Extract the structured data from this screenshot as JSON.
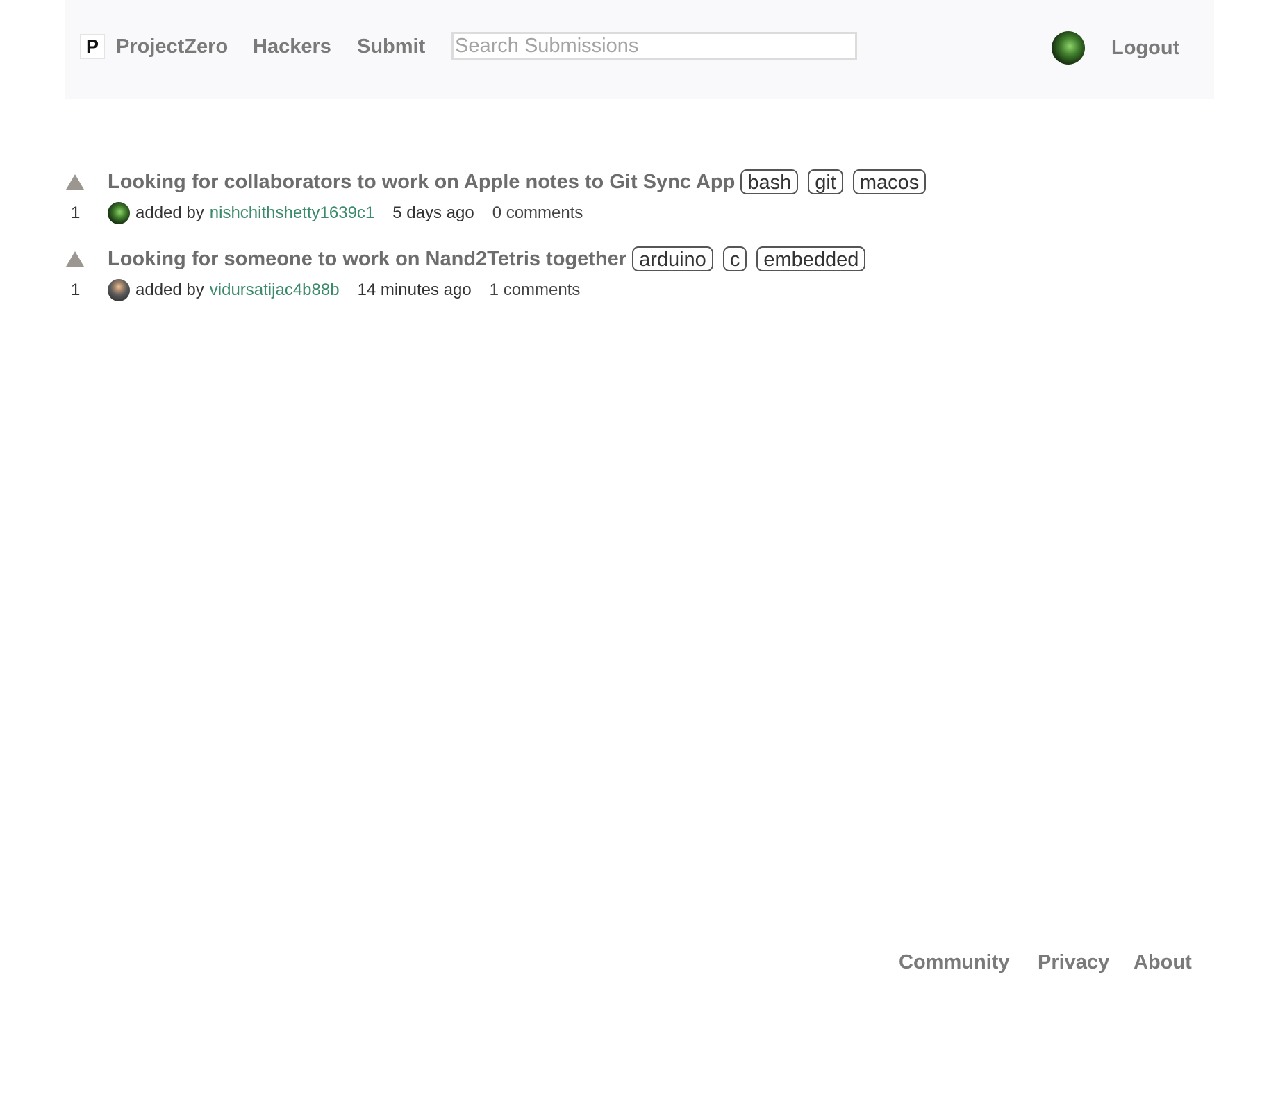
{
  "header": {
    "logo_letter": "P",
    "brand": "ProjectZero",
    "nav": {
      "hackers": "Hackers",
      "submit": "Submit"
    },
    "search": {
      "placeholder": "Search Submissions",
      "value": ""
    },
    "logout": "Logout"
  },
  "submissions": [
    {
      "title": "Looking for collaborators to work on Apple notes to Git Sync App",
      "tags": [
        "bash",
        "git",
        "macos"
      ],
      "points": "1",
      "added_by_label": "added by",
      "author": "nishchithshetty1639c1",
      "time": "5 days ago",
      "comments": "0 comments"
    },
    {
      "title": "Looking for someone to work on Nand2Tetris together",
      "tags": [
        "arduino",
        "c",
        "embedded"
      ],
      "points": "1",
      "added_by_label": "added by",
      "author": "vidursatijac4b88b",
      "time": "14 minutes ago",
      "comments": "1 comments"
    }
  ],
  "footer": {
    "community": "Community",
    "privacy": "Privacy",
    "about": "About"
  },
  "colors": {
    "nav_background": "#f9f9fb",
    "nav_text": "#7a7a7a",
    "author_link": "#3b8a6b",
    "vote_arrow": "#9b9790",
    "tag_border": "#555555"
  },
  "icons": {
    "upvote": "upvote-triangle-icon",
    "logo": "logo-icon",
    "avatar": "avatar"
  }
}
